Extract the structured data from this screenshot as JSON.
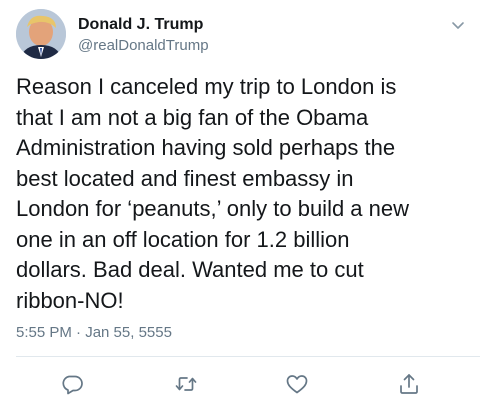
{
  "user": {
    "display_name": "Donald J. Trump",
    "handle": "@realDonaldTrump",
    "avatar_icon": "profile-photo"
  },
  "tweet": {
    "text": "Reason I canceled my trip to London is\nthat I am not a big fan of the Obama\nAdministration having sold perhaps the\nbest located and finest embassy in\nLondon for ‘peanuts,’ only to build a new\none in an off location for 1.2 billion\ndollars. Bad deal. Wanted me to cut\nribbon-NO!",
    "timestamp": "5:55 PM · Jan 55, 5555"
  },
  "actions": {
    "icons": [
      "reply-icon",
      "retweet-icon",
      "like-icon",
      "share-icon"
    ],
    "color": "#657786"
  },
  "colors": {
    "text": "#14171a",
    "secondary": "#657786",
    "divider": "#e1e8ed"
  }
}
